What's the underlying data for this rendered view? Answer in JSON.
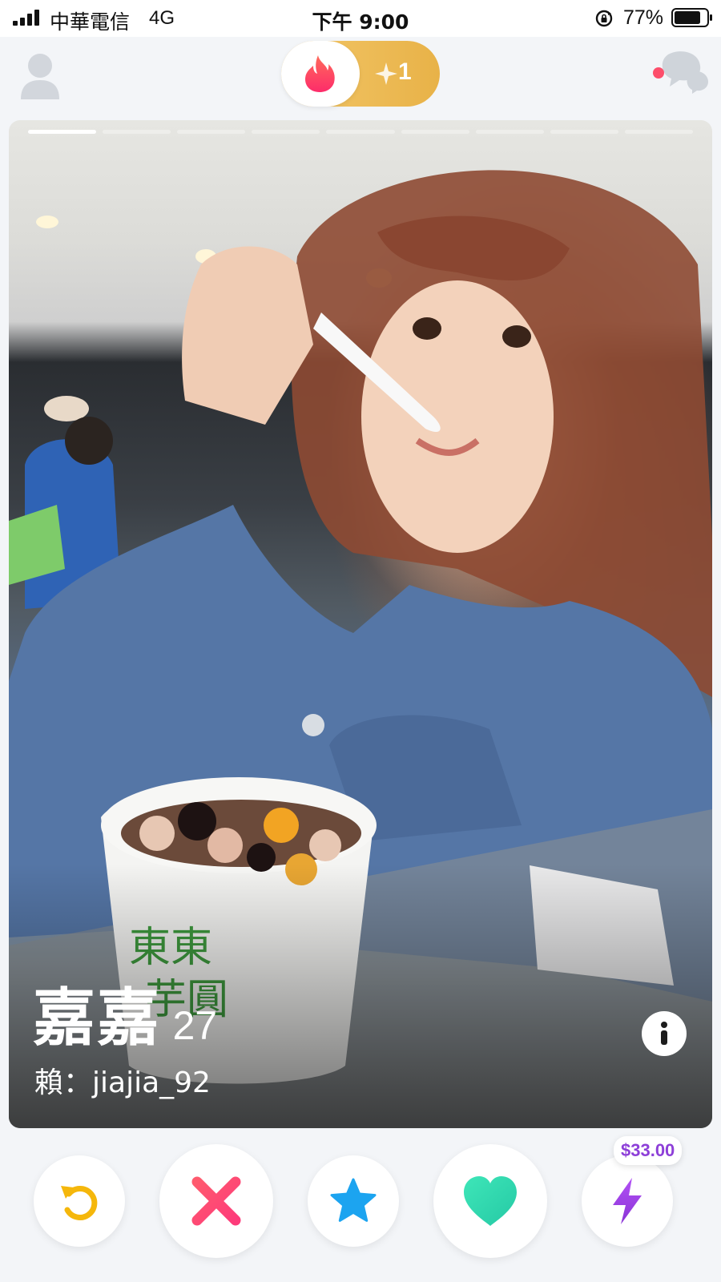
{
  "status_bar": {
    "carrier": "中華電信",
    "network": "4G",
    "time": "下午 9:00",
    "battery": "77%"
  },
  "top_nav": {
    "gold_likes": "1"
  },
  "card": {
    "name": "嘉嘉",
    "age": "27",
    "bio": "賴：jiajia_92"
  },
  "actions": {
    "boost_price": "$33.00"
  },
  "colors": {
    "brand": "#fd4e6b",
    "gold": "#eab54d",
    "rewind": "#f5b70b",
    "nope": "#fd4e6b",
    "super_like": "#1ca4f0",
    "like": "#2fd8b0",
    "boost": "#9b3ee6"
  }
}
